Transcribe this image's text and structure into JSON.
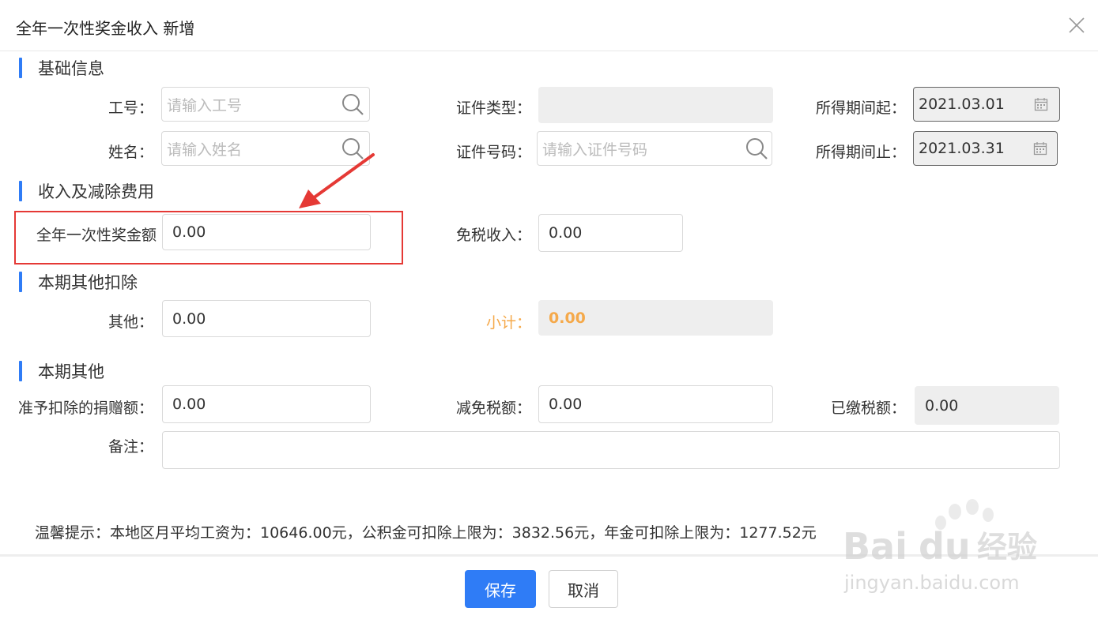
{
  "dialog": {
    "title": "全年一次性奖金收入 新增"
  },
  "sections": {
    "basic": "基础信息",
    "income": "收入及减除费用",
    "deduction": "本期其他扣除",
    "other": "本期其他"
  },
  "basic": {
    "emp_no_label": "工号：",
    "emp_no_placeholder": "请输入工号",
    "name_label": "姓名：",
    "name_placeholder": "请输入姓名",
    "id_type_label": "证件类型：",
    "id_type_value": "",
    "id_no_label": "证件号码：",
    "id_no_placeholder": "请输入证件号码",
    "period_start_label": "所得期间起：",
    "period_start_value": "2021.03.01",
    "period_end_label": "所得期间止：",
    "period_end_value": "2021.03.31"
  },
  "income": {
    "bonus_label": "全年一次性奖金额",
    "bonus_value": "0.00",
    "taxfree_label": "免税收入：",
    "taxfree_value": "0.00"
  },
  "deduction": {
    "other_label": "其他：",
    "other_value": "0.00",
    "subtotal_label": "小计：",
    "subtotal_value": "0.00"
  },
  "other": {
    "donation_label": "准予扣除的捐赠额：",
    "donation_value": "0.00",
    "relief_label": "减免税额：",
    "relief_value": "0.00",
    "paid_label": "已缴税额：",
    "paid_value": "0.00",
    "remark_label": "备注：",
    "remark_value": ""
  },
  "tip": "温馨提示：本地区月平均工资为：10646.00元，公积金可扣除上限为：3832.56元，年金可扣除上限为：1277.52元",
  "buttons": {
    "save": "保存",
    "cancel": "取消"
  },
  "watermark": {
    "brand": "Bai",
    "brand2": "du",
    "product": "经验",
    "url": "jingyan.baidu.com"
  },
  "colors": {
    "accent": "#2f7cf6",
    "subtotal": "#f5a94a",
    "annotation": "#e53935"
  }
}
